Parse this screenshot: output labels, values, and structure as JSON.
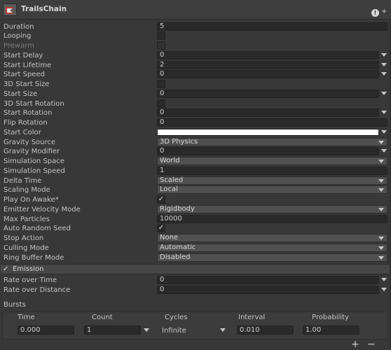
{
  "header": {
    "title": "TrailsChain",
    "info_glyph": "!",
    "plus_glyph": "+"
  },
  "props": {
    "duration": {
      "label": "Duration",
      "value": "5"
    },
    "looping": {
      "label": "Looping",
      "checked": false
    },
    "prewarm": {
      "label": "Prewarm",
      "checked": false
    },
    "start_delay": {
      "label": "Start Delay",
      "value": "0"
    },
    "start_lifetime": {
      "label": "Start Lifetime",
      "value": "2"
    },
    "start_speed": {
      "label": "Start Speed",
      "value": "0"
    },
    "start_size_3d": {
      "label": "3D Start Size",
      "checked": false
    },
    "start_size": {
      "label": "Start Size",
      "value": "0"
    },
    "start_rotation_3d": {
      "label": "3D Start Rotation",
      "checked": false
    },
    "start_rotation": {
      "label": "Start Rotation",
      "value": "0"
    },
    "flip_rotation": {
      "label": "Flip Rotation",
      "value": "0"
    },
    "start_color": {
      "label": "Start Color",
      "color": "#ffffff"
    },
    "gravity_source": {
      "label": "Gravity Source",
      "value": "3D Physics"
    },
    "gravity_modifier": {
      "label": "Gravity Modifier",
      "value": "0"
    },
    "simulation_space": {
      "label": "Simulation Space",
      "value": "World"
    },
    "simulation_speed": {
      "label": "Simulation Speed",
      "value": "1"
    },
    "delta_time": {
      "label": "Delta Time",
      "value": "Scaled"
    },
    "scaling_mode": {
      "label": "Scaling Mode",
      "value": "Local"
    },
    "play_on_awake": {
      "label": "Play On Awake*",
      "checked": true,
      "mark": "✓"
    },
    "emitter_velocity_mode": {
      "label": "Emitter Velocity Mode",
      "value": "Rigidbody"
    },
    "max_particles": {
      "label": "Max Particles",
      "value": "10000"
    },
    "auto_random_seed": {
      "label": "Auto Random Seed",
      "checked": true,
      "mark": "✓"
    },
    "stop_action": {
      "label": "Stop Action",
      "value": "None"
    },
    "culling_mode": {
      "label": "Culling Mode",
      "value": "Automatic"
    },
    "ring_buffer_mode": {
      "label": "Ring Buffer Mode",
      "value": "Disabled"
    }
  },
  "emission": {
    "label": "Emission",
    "enabled": true,
    "mark": "✓",
    "rate_over_time": {
      "label": "Rate over Time",
      "value": "0"
    },
    "rate_over_distance": {
      "label": "Rate over Distance",
      "value": "0"
    },
    "bursts": {
      "label": "Bursts",
      "columns": [
        "Time",
        "Count",
        "Cycles",
        "Interval",
        "Probability"
      ],
      "row": {
        "time": "0.000",
        "count": "1",
        "cycles": "Infinite",
        "interval": "0.010",
        "probability": "1.00"
      },
      "add_glyph": "+",
      "remove_glyph": "−"
    }
  }
}
